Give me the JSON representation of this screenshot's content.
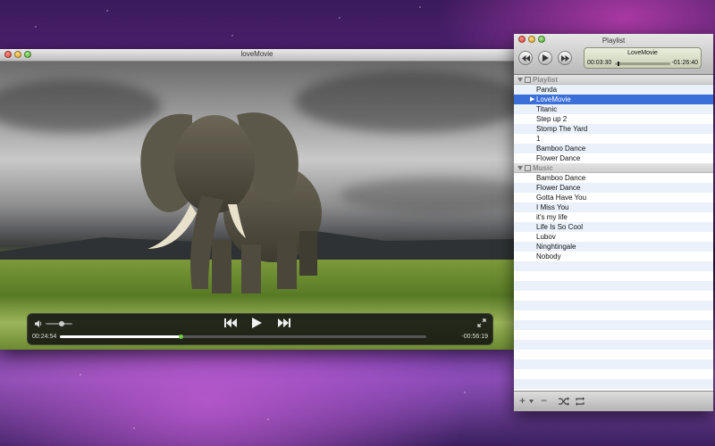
{
  "video_window": {
    "title": "loveMovie",
    "elapsed": "00:24:54",
    "remaining": "-00:56:19",
    "progress": 0.33,
    "volume": 0.6
  },
  "playlist_window": {
    "title": "Playlist",
    "now_playing": "LoveMovie",
    "elapsed": "00:03:30",
    "remaining": "-01:26:40",
    "progress": 0.05,
    "groups": [
      {
        "label": "Playlist",
        "items": [
          "Panda",
          "LoveMovie",
          "Titanic",
          "Step up 2",
          "Stomp The Yard",
          "1",
          "Bamboo Dance",
          "Flower Dance"
        ]
      },
      {
        "label": "Music",
        "items": [
          "Bamboo Dance",
          "Flower Dance",
          "Gotta Have You",
          "I Miss You",
          "it's my life",
          "Life Is So Cool",
          "Lubov",
          "Ninghtingale",
          "Nobody"
        ]
      }
    ],
    "selected_item": "LoveMovie",
    "bottom_buttons": {
      "add": "+",
      "remove": "−"
    }
  },
  "colors": {
    "selection": "#3a6ed8",
    "progress_knob": "#6ccf3d"
  }
}
